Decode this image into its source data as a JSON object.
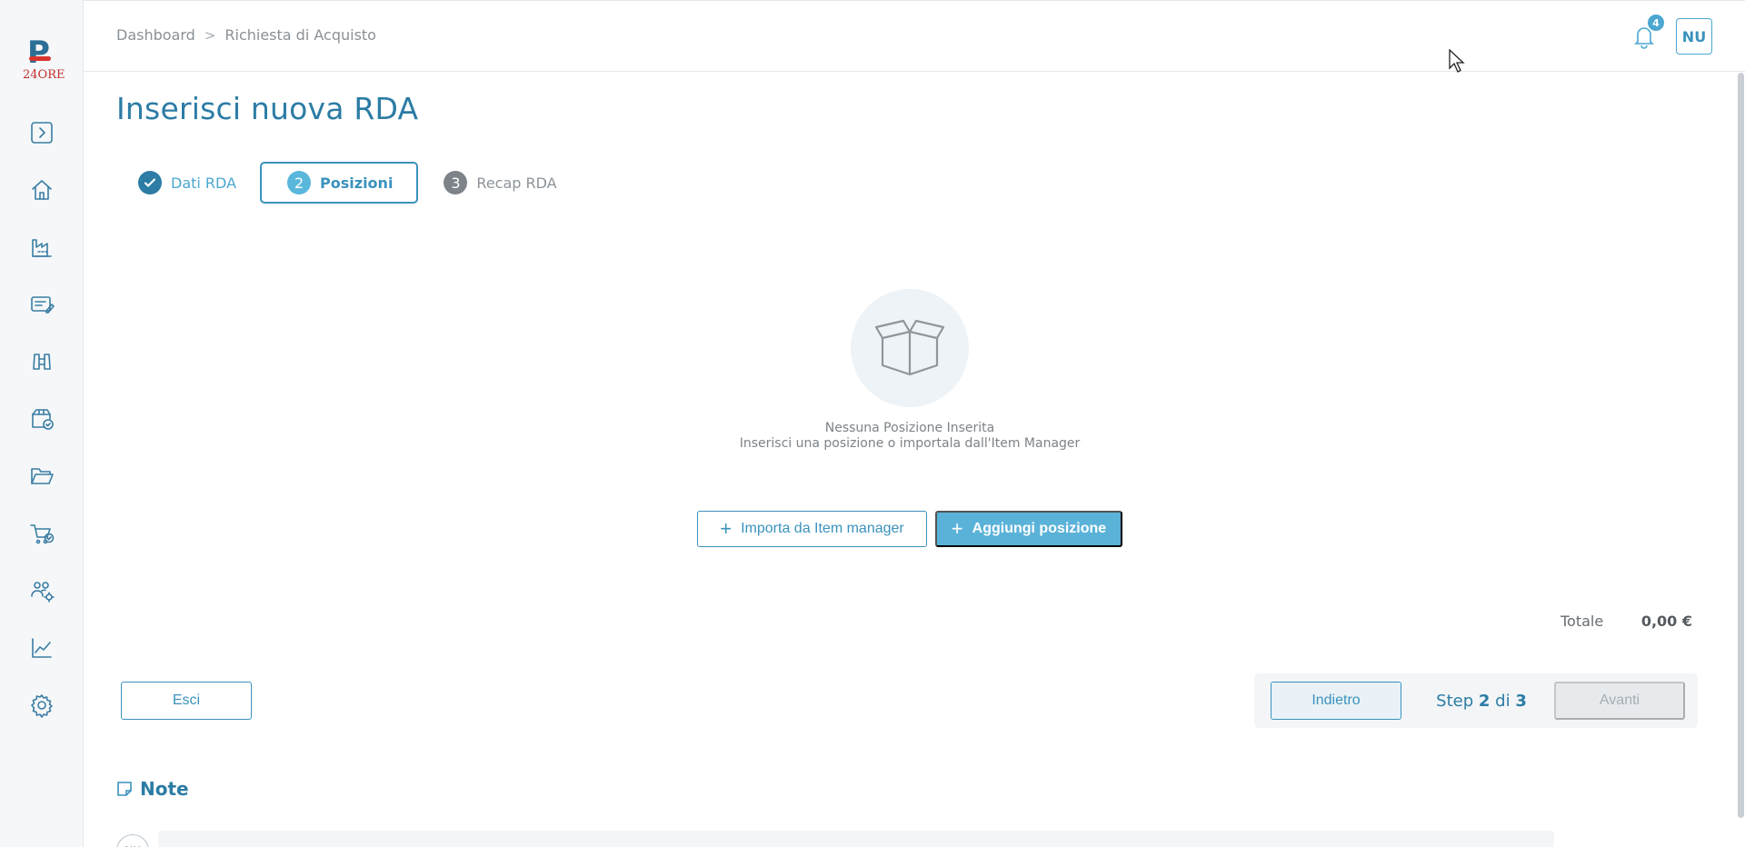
{
  "app": {
    "logo_text": "24ORE"
  },
  "header": {
    "breadcrumb": [
      "Dashboard",
      "Richiesta di Acquisto"
    ],
    "separator": ">",
    "notifications_count": "4",
    "user_initials": "NU"
  },
  "sidebar": {
    "items": [
      {
        "name": "expand",
        "icon": "chevron-right-box-icon"
      },
      {
        "name": "home",
        "icon": "home-icon"
      },
      {
        "name": "suppliers",
        "icon": "factory-icon"
      },
      {
        "name": "contracts",
        "icon": "edit-document-icon"
      },
      {
        "name": "search",
        "icon": "binoculars-icon"
      },
      {
        "name": "orders",
        "icon": "package-check-icon"
      },
      {
        "name": "documents",
        "icon": "folder-open-icon"
      },
      {
        "name": "purchases",
        "icon": "cart-check-icon"
      },
      {
        "name": "users",
        "icon": "users-gear-icon"
      },
      {
        "name": "analytics",
        "icon": "chart-line-icon"
      },
      {
        "name": "settings",
        "icon": "gear-icon"
      }
    ]
  },
  "page": {
    "title": "Inserisci nuova RDA"
  },
  "stepper": {
    "steps": [
      {
        "number": "",
        "label": "Dati RDA",
        "state": "done"
      },
      {
        "number": "2",
        "label": "Posizioni",
        "state": "active"
      },
      {
        "number": "3",
        "label": "Recap RDA",
        "state": "todo"
      }
    ]
  },
  "empty_state": {
    "title": "Nessuna Posizione Inserita",
    "subtitle": "Inserisci una posizione o importala dall'Item Manager"
  },
  "actions": {
    "import_label": "Importa da Item manager",
    "add_label": "Aggiungi posizione",
    "plus": "+"
  },
  "summary": {
    "total_label": "Totale",
    "total_value": "0,00 €"
  },
  "footer": {
    "exit_label": "Esci",
    "back_label": "Indietro",
    "step_word": "Step",
    "current_step": "2",
    "of_word": "di",
    "total_steps": "3",
    "next_label": "Avanti"
  },
  "notes": {
    "title": "Note",
    "avatar_initials": "NU",
    "input_value": ""
  },
  "colors": {
    "primary": "#2c7ca5",
    "accent": "#5ab2d8",
    "sidebar_bg": "#f5f7f9"
  }
}
